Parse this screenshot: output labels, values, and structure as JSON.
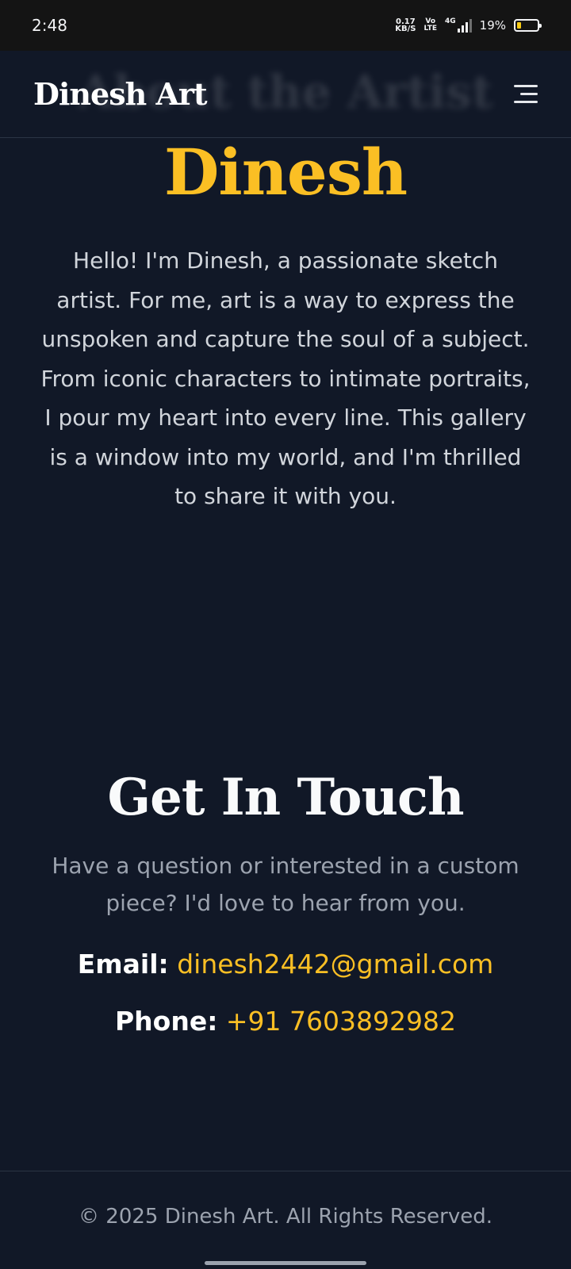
{
  "status_bar": {
    "time": "2:48",
    "net_rate_value": "0.17",
    "net_rate_unit": "KB/S",
    "volte_top": "Vo",
    "volte_bottom": "LTE",
    "network": "4G",
    "battery_percent": "19%",
    "battery_level": 0.19,
    "battery_color": "#facc15"
  },
  "header": {
    "brand": "Dinesh Art",
    "scrolled_section_title": "About the Artist",
    "menu_icon": "hamburger-menu-icon"
  },
  "about": {
    "name": "Dinesh",
    "bio": "Hello! I'm Dinesh, a passionate sketch artist. For me, art is a way to express the unspoken and capture the soul of a subject. From iconic characters to intimate portraits, I pour my heart into every line. This gallery is a window into my world, and I'm thrilled to share it with you."
  },
  "contact": {
    "title": "Get In Touch",
    "subtitle": "Have a question or interested in a custom piece? I'd love to hear from you.",
    "email_label": "Email:",
    "email_value": "dinesh2442@gmail.com",
    "phone_label": "Phone:",
    "phone_value": "+91 7603892982"
  },
  "footer": {
    "copyright": "© 2025 Dinesh Art. All Rights Reserved."
  },
  "colors": {
    "background": "#111827",
    "accent": "#fbbf24",
    "heading": "#f9fafb",
    "body_text": "#d1d5db",
    "muted_text": "#9ca3af"
  }
}
